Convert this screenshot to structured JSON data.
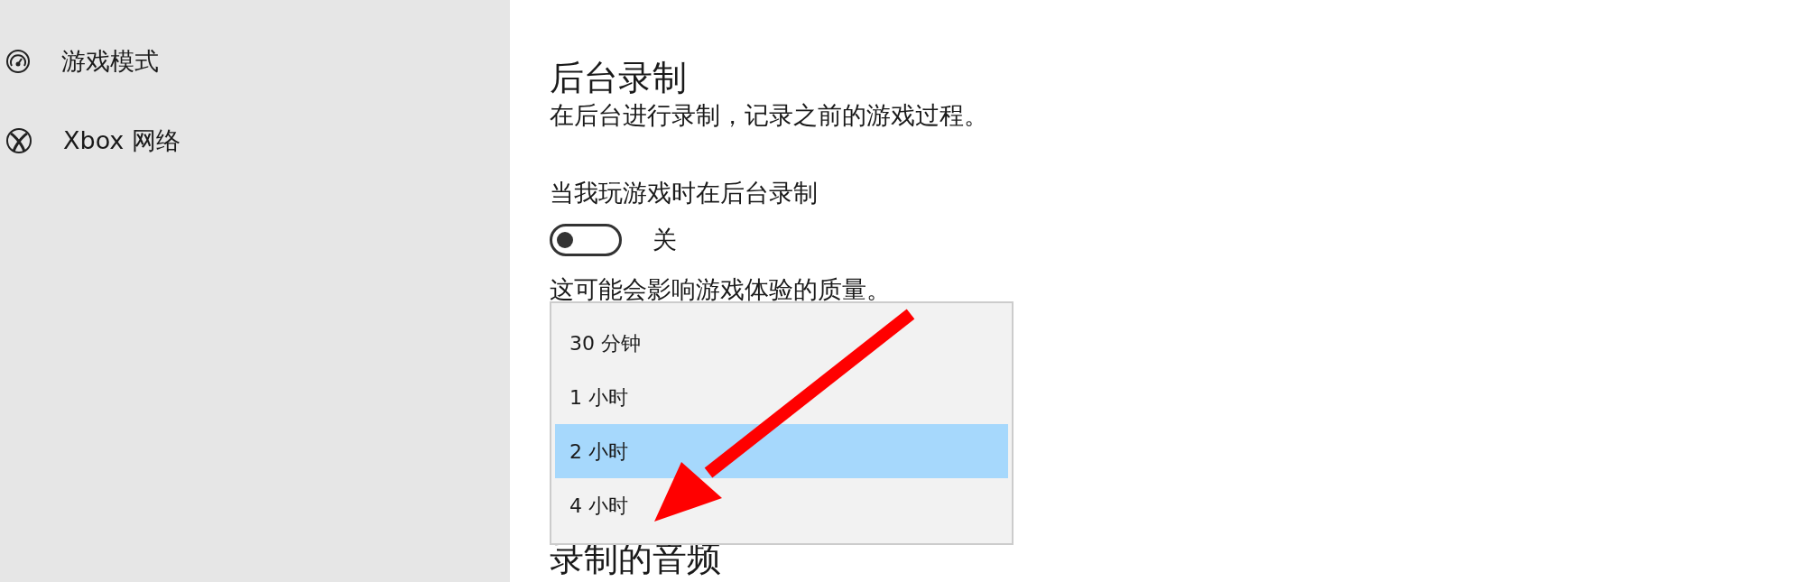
{
  "sidebar": {
    "items": [
      {
        "label": "游戏模式",
        "kind": "gauge"
      },
      {
        "label": "Xbox 网络",
        "kind": "xbox"
      }
    ]
  },
  "section": {
    "title": "后台录制",
    "description": "在后台进行录制，记录之前的游戏过程。",
    "toggle": {
      "label": "当我玩游戏时在后台录制",
      "on": false,
      "state_text": "关"
    },
    "note": "这可能会影响游戏体验的质量。"
  },
  "dropdown": {
    "options": [
      {
        "label": "30 分钟",
        "selected": false
      },
      {
        "label": "1 小时",
        "selected": false
      },
      {
        "label": "2 小时",
        "selected": true
      },
      {
        "label": "4 小时",
        "selected": false
      }
    ]
  },
  "next_section": {
    "title": "录制的音频"
  }
}
